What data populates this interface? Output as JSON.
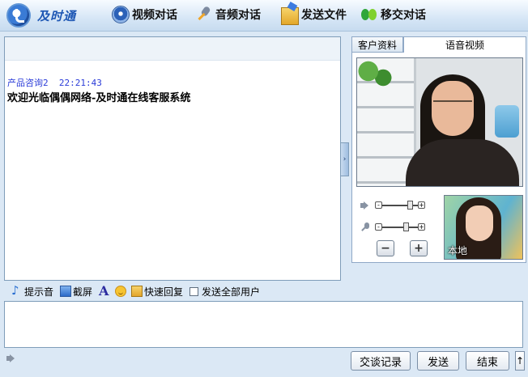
{
  "app": {
    "logo_text": "及时通"
  },
  "toolbar": {
    "video_chat": "视频对话",
    "audio_chat": "音频对话",
    "send_file": "发送文件",
    "transfer_chat": "移交对话"
  },
  "chat": {
    "messages": [
      {
        "sender": "产品咨询2",
        "time": "22:21:43",
        "text": "欢迎光临偶偶网络-及时通在线客服系统"
      }
    ]
  },
  "side_tabs": {
    "customer_info": "客户资料",
    "voice_video": "语音视频"
  },
  "video": {
    "local_label": "本地",
    "speaker_volume": 0.85,
    "mic_volume": 0.7
  },
  "input_tools": {
    "alert_sound": "提示音",
    "screenshot": "截屏",
    "quick_reply": "快速回复",
    "send_all_users": "发送全部用户",
    "send_all_checked": false
  },
  "input": {
    "value": ""
  },
  "buttons": {
    "history": "交谈记录",
    "send": "发送",
    "end": "结束",
    "more": "↑"
  },
  "icons": [
    "logo-icon",
    "webcam-icon",
    "microphone-icon",
    "folder-icon",
    "transfer-icon",
    "speaker-icon",
    "mic-icon",
    "music-note-icon",
    "monitor-icon",
    "font-icon",
    "smiley-icon",
    "quick-reply-icon"
  ]
}
